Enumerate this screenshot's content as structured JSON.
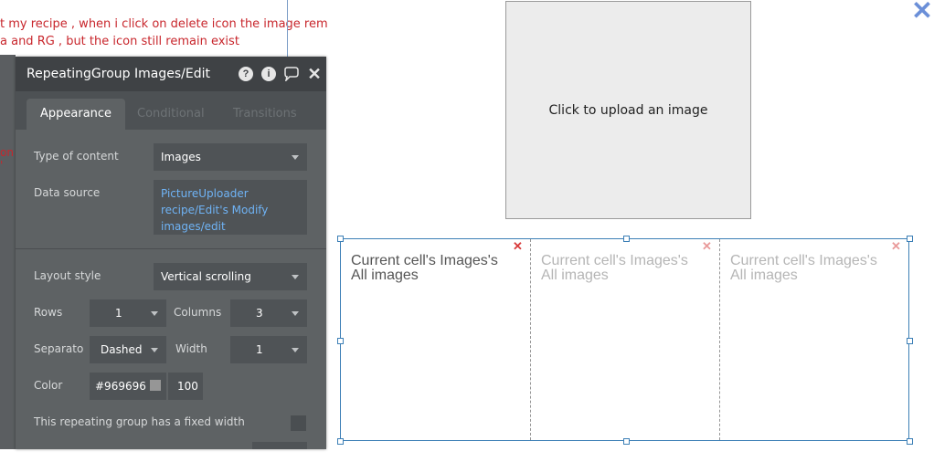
{
  "background": {
    "line1": "t my recipe , when i click on delete icon the image rem",
    "line2": "a and RG  , but the icon still remain exist",
    "line3": "on '"
  },
  "panel": {
    "title": "RepeatingGroup Images/Edit",
    "header_icons": [
      "question-icon",
      "info-icon",
      "comment-icon",
      "close-icon"
    ],
    "tabs": [
      "Appearance",
      "Conditional",
      "Transitions"
    ],
    "active_tab": "Appearance",
    "type_of_content": {
      "label": "Type of content",
      "value": "Images"
    },
    "data_source": {
      "label": "Data source",
      "value": "PictureUploader\nrecipe/Edit's Modify\nimages/edit"
    },
    "layout_style": {
      "label": "Layout style",
      "value": "Vertical scrolling"
    },
    "rows": {
      "label": "Rows",
      "value": "1"
    },
    "columns": {
      "label": "Columns",
      "value": "3"
    },
    "separator": {
      "label": "Separato",
      "value": "Dashed"
    },
    "width": {
      "label": "Width",
      "value": "1"
    },
    "color": {
      "label": "Color",
      "hex": "#969696",
      "opacity": "100"
    },
    "fixed_width": {
      "label": "This repeating group has a fixed width"
    }
  },
  "canvas": {
    "upload_text": "Click to upload an image",
    "cells": [
      {
        "text": "Current cell's Images's All images",
        "color": "#555555",
        "x_color": "#d83a3a"
      },
      {
        "text": "Current cell's Images's All images",
        "color": "#b5b5b5",
        "x_color": "#e99a9a"
      },
      {
        "text": "Current cell's Images's All images",
        "color": "#b5b5b5",
        "x_color": "#e99a9a"
      }
    ]
  }
}
